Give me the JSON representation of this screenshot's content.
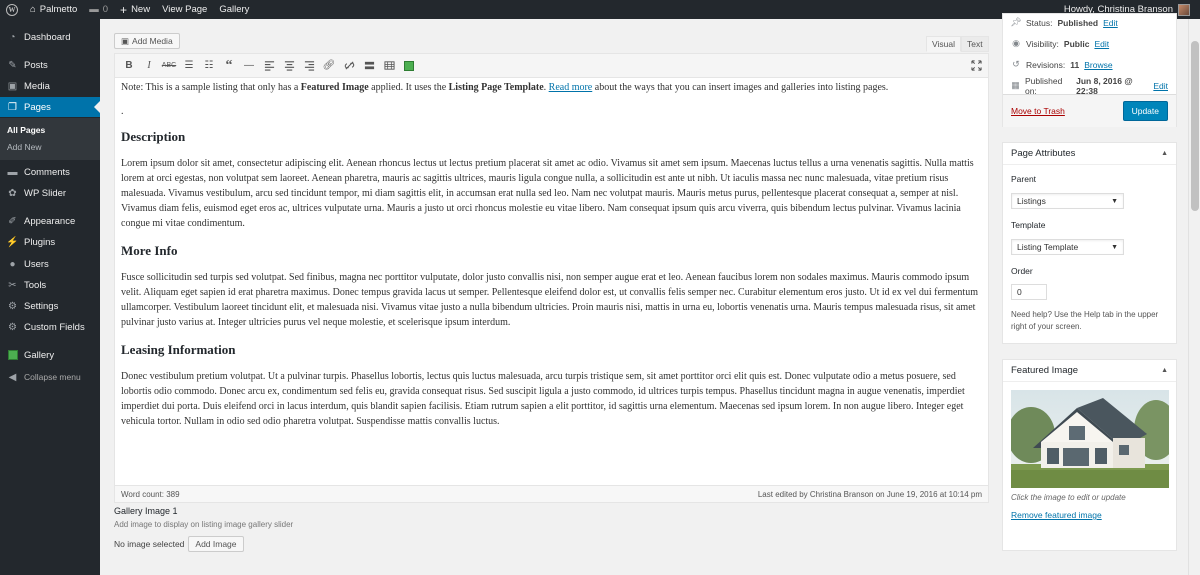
{
  "adminbar": {
    "site_name": "Palmetto",
    "comments_count": "0",
    "new_label": "New",
    "view_page_label": "View Page",
    "gallery_label": "Gallery",
    "howdy": "Howdy, Christina Branson"
  },
  "sidebar": {
    "items": [
      {
        "label": "Dashboard",
        "icon": "dashboard-icon"
      },
      {
        "label": "Posts",
        "icon": "pin-icon"
      },
      {
        "label": "Media",
        "icon": "media-icon"
      },
      {
        "label": "Pages",
        "icon": "pages-icon"
      },
      {
        "label": "Comments",
        "icon": "comments-icon"
      },
      {
        "label": "WP Slider",
        "icon": "slider-icon"
      },
      {
        "label": "Appearance",
        "icon": "brush-icon"
      },
      {
        "label": "Plugins",
        "icon": "plugin-icon"
      },
      {
        "label": "Users",
        "icon": "users-icon"
      },
      {
        "label": "Tools",
        "icon": "wrench-icon"
      },
      {
        "label": "Settings",
        "icon": "settings-icon"
      },
      {
        "label": "Custom Fields",
        "icon": "custom-fields-icon"
      },
      {
        "label": "Gallery",
        "icon": "gallery-icon"
      },
      {
        "label": "Collapse menu",
        "icon": "collapse-icon"
      }
    ],
    "submenu": {
      "all_pages": "All Pages",
      "add_new": "Add New"
    }
  },
  "editor": {
    "add_media": "Add Media",
    "tab_visual": "Visual",
    "tab_text": "Text",
    "note_prefix": "Note: This is a sample listing that only has a ",
    "note_bold1": "Featured Image",
    "note_mid": " applied. It uses the ",
    "note_bold2": "Listing Page Template",
    "note_after": ". ",
    "note_link": "Read more",
    "note_suffix": " about the ways that you can insert images and galleries into listing pages.",
    "dot": ".",
    "h_description": "Description",
    "p_description": "Lorem ipsum dolor sit amet, consectetur adipiscing elit. Aenean rhoncus lectus ut lectus pretium placerat sit amet ac odio. Vivamus sit amet sem ipsum. Maecenas luctus tellus a urna venenatis sagittis. Nulla mattis lorem at orci egestas, non volutpat sem laoreet. Aenean pharetra, mauris ac sagittis ultrices, mauris ligula congue nulla, a sollicitudin est ante ut nibh. Ut iaculis massa nec nunc malesuada, vitae pretium risus malesuada. Vivamus vestibulum, arcu sed tincidunt tempor, mi diam sagittis elit, in accumsan erat nulla sed leo. Nam nec volutpat mauris. Mauris metus purus, pellentesque placerat consequat a, semper at nisl. Vivamus diam felis, euismod eget eros ac, ultrices vulputate urna. Mauris a justo ut orci rhoncus molestie eu vitae libero. Nam consequat ipsum quis arcu viverra, quis bibendum lectus pulvinar. Vivamus lacinia congue mi vitae condimentum.",
    "h_more": "More Info",
    "p_more": "Fusce sollicitudin sed turpis sed volutpat. Sed finibus, magna nec porttitor vulputate, dolor justo convallis nisi, non semper augue erat et leo. Aenean faucibus lorem non sodales maximus. Mauris commodo ipsum velit. Aliquam eget sapien id erat pharetra maximus. Donec tempus gravida lacus ut semper. Pellentesque eleifend dolor est, ut convallis felis semper nec. Curabitur elementum eros justo. Ut id ex vel dui fermentum ullamcorper. Vestibulum laoreet tincidunt elit, et malesuada nisi. Vivamus vitae justo a nulla bibendum ultricies. Proin mauris nisi, mattis in urna eu, lobortis venenatis urna. Mauris tempus malesuada risus, sit amet pulvinar justo varius at. Integer ultricies purus vel neque molestie, et scelerisque ipsum interdum.",
    "h_leasing": "Leasing Information",
    "p_leasing": "Donec vestibulum pretium volutpat. Ut a pulvinar turpis. Phasellus lobortis, lectus quis luctus malesuada, arcu turpis tristique sem, sit amet porttitor orci elit quis est. Donec vulputate odio a metus posuere, sed lobortis odio commodo. Donec arcu ex, condimentum sed felis eu, gravida consequat risus. Sed suscipit ligula a justo commodo, id ultrices turpis tempus. Phasellus tincidunt magna in augue venenatis, imperdiet imperdiet dui porta. Duis eleifend orci in lacus interdum, quis blandit sapien facilisis. Etiam rutrum sapien a elit porttitor, id sagittis urna elementum. Maecenas sed ipsum lorem. In non augue libero. Integer eget vehicula tortor. Nullam in odio sed odio pharetra volutpat. Suspendisse mattis convallis luctus.",
    "word_count": "Word count: 389",
    "last_edited": "Last edited by Christina Branson on June 19, 2016 at 10:14 pm"
  },
  "gallery_field": {
    "title": "Gallery Image 1",
    "description": "Add image to display on listing image gallery slider",
    "no_image": "No image selected",
    "add_image": "Add Image"
  },
  "publish": {
    "status_label": "Status: ",
    "status_value": "Published",
    "edit": "Edit",
    "visibility_label": "Visibility: ",
    "visibility_value": "Public",
    "revisions_label": "Revisions: ",
    "revisions_value": "11",
    "browse": "Browse",
    "published_label": "Published on: ",
    "published_value": "Jun 8, 2016 @ 22:38",
    "trash": "Move to Trash",
    "update": "Update"
  },
  "page_attributes": {
    "title": "Page Attributes",
    "parent_label": "Parent",
    "parent_value": "Listings",
    "template_label": "Template",
    "template_value": "Listing Template",
    "order_label": "Order",
    "order_value": "0",
    "help": "Need help? Use the Help tab in the upper right of your screen."
  },
  "featured_image": {
    "title": "Featured Image",
    "caption": "Click the image to edit or update",
    "remove": "Remove featured image"
  },
  "colors": {
    "accent": "#0073aa",
    "sidebar_bg": "#23282d",
    "trash": "#a00"
  }
}
